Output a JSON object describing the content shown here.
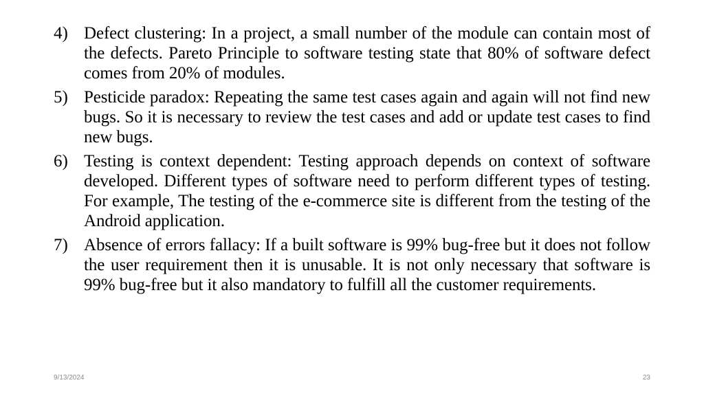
{
  "slide": {
    "items": [
      {
        "number": "4)",
        "text": "Defect clustering:  In a project, a small number of the module can contain most of the defects. Pareto Principle to software testing state that 80% of software defect comes from 20% of modules."
      },
      {
        "number": "5)",
        "text": "Pesticide paradox: Repeating the same test cases again and again will not find new bugs. So it is necessary to review the test cases and add or update test cases to find new bugs."
      },
      {
        "number": "6)",
        "text": "Testing is context dependent: Testing approach depends on context of software developed. Different types of software need to perform different types of testing. For example, The testing of the e-commerce site is different from the testing of the Android application."
      },
      {
        "number": "7)",
        "text": "Absence of errors fallacy: If a built software is 99% bug-free but it does not follow the user requirement then it is unusable. It is not only necessary that software is 99% bug-free but it also mandatory to fulfill all the customer requirements."
      }
    ]
  },
  "footer": {
    "date": "9/13/2024",
    "page_number": "23"
  }
}
